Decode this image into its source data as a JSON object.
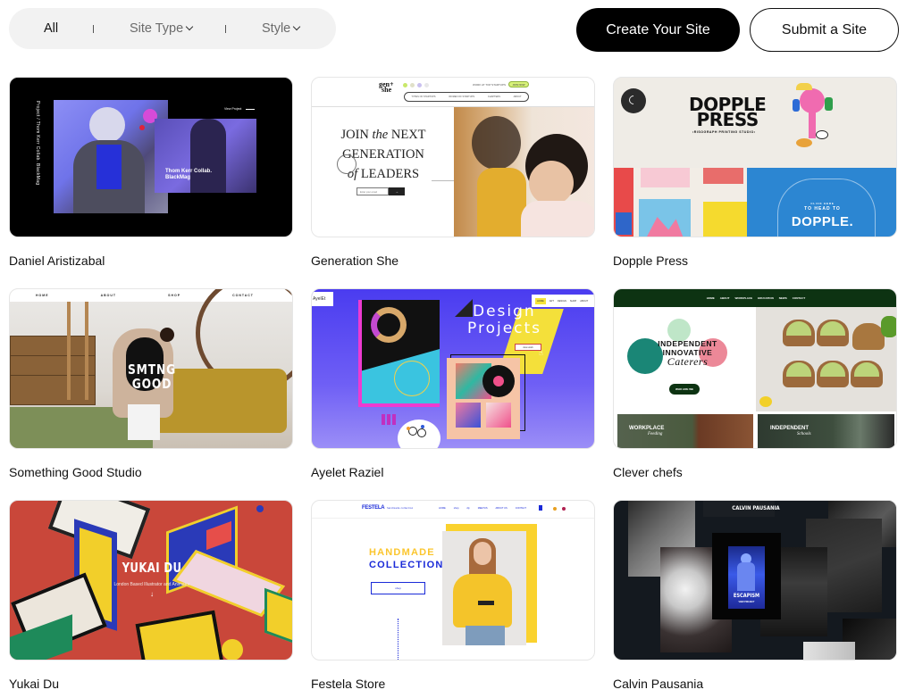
{
  "filters": {
    "all_label": "All",
    "site_type_label": "Site Type",
    "style_label": "Style",
    "separator": "|"
  },
  "actions": {
    "create_label": "Create Your Site",
    "submit_label": "Submit a Site"
  },
  "sites": [
    {
      "title": "Daniel Aristizabal",
      "thumb": {
        "vertical_text": "Project / Thom Kerr Collab. BlackMag",
        "link_text": "View Project",
        "caption_line1": "Thom Kerr Collab.",
        "caption_line2": "BlackMag"
      }
    },
    {
      "title": "Generation She",
      "thumb": {
        "logo_line1": "gen+",
        "logo_line2": "she",
        "nav_items": [
          "TYPES OF STARTUPS",
          "WOMEN OF STARTUPS",
          "CHAPTERS",
          "ABOUT"
        ],
        "top_link": "WORK AT TOP STARTUPS",
        "cta": "JOIN NOW",
        "headline_1": "JOIN",
        "headline_1_italic": "the",
        "headline_1b": "NEXT",
        "headline_2": "GENERATION",
        "headline_3_italic": "of",
        "headline_3": "LEADERS",
        "email_placeholder": "Enter your email",
        "submit_arrow": "→"
      }
    },
    {
      "title": "Dopple Press",
      "thumb": {
        "headline_1": "DOPPLE",
        "headline_2": "PRESS",
        "subtitle": "•RISOGRAPH PRINTING STUDIO•",
        "banner_small": "CLICK HERE",
        "banner_mid": "TO HEAD TO",
        "banner_big": "DOPPLE."
      }
    },
    {
      "title": "Something Good Studio",
      "thumb": {
        "nav_items": [
          "HOME",
          "ABOUT",
          "SHOP",
          "CONTACT"
        ],
        "headline_1": "SMTNG",
        "headline_2": "GOOD"
      }
    },
    {
      "title": "Ayelet Raziel",
      "thumb": {
        "logo": "AyelEt",
        "nav_items": [
          "HOME",
          "ART",
          "DESIGN",
          "SHOP",
          "ABOUT"
        ],
        "headline_1": "Design",
        "headline_2": "Projects",
        "button": "view work"
      }
    },
    {
      "title": "Clever chefs",
      "thumb": {
        "nav_items": [
          "HOME",
          "ABOUT",
          "WORKPLACE",
          "EDUCATION",
          "NEWS",
          "CONTACT"
        ],
        "headline_1": "INDEPENDENT",
        "headline_2": "INNOVATIVE",
        "headline_script": "Caterers",
        "button": "WHO ARE WE",
        "panel_1_title": "WORKPLACE",
        "panel_1_script": "Feeding",
        "panel_2_title": "INDEPENDENT",
        "panel_2_script": "Schools"
      }
    },
    {
      "title": "Yukai Du",
      "thumb": {
        "headline": "YUKAI DU",
        "subtitle": "London Based Illustrator and Animator",
        "arrow": "↓"
      }
    },
    {
      "title": "Festela Store",
      "thumb": {
        "logo": "FESTELA",
        "tagline": "handmade collection",
        "nav_items": [
          "HOME",
          "shop",
          "diy",
          "MEETUS",
          "ABOUT US",
          "CONTACT"
        ],
        "headline_1": "HANDMADE",
        "headline_2": "COLLECTION",
        "button": "shop"
      }
    },
    {
      "title": "Calvin Pausania",
      "thumb": {
        "header": "CALVIN PAUSANIA",
        "poster_title": "ESCAPISM",
        "poster_sub": "VIEW PROJECT"
      }
    }
  ],
  "colors": {
    "primary_button_bg": "#000000",
    "filter_bar_bg": "#f2f2f2",
    "muted_text": "#6b6b6b"
  }
}
